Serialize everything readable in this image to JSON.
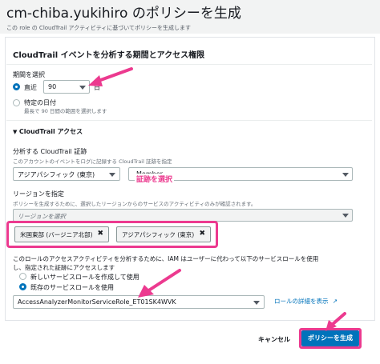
{
  "header": {
    "title": "cm-chiba.yukihiro のポリシーを生成",
    "description": "この role の CloudTrail アクティビティに基づいてポリシーを生成します"
  },
  "cloudtrail_section": {
    "title": "CloudTrail イベントを分析する期間とアクセス権限",
    "period_label": "期間を選択",
    "recent_label": "直近",
    "days_value": "90",
    "days_unit": "日",
    "specific_date_label": "特定の日付",
    "specific_date_hint": "最長で 90 日間の範囲を選択します"
  },
  "access_section": {
    "toggle_label": "CloudTrail アクセス",
    "trail_label": "分析する CloudTrail 証跡",
    "trail_hint": "このアカウントのイベントをログに記録する CloudTrail 証跡を指定",
    "trail_region_value": "アジアパシフィック (東京)",
    "trail_select_value": "Member",
    "annotation_trail": "証跡を選択",
    "region_label": "リージョンを指定",
    "region_hint": "ポリシーを生成するために、選択したリージョンからのサービスのアクティビティのみが確認されます。",
    "region_placeholder": "リージョンを選択",
    "region_tokens": [
      "米国東部 (バージニア北部)",
      "アジアパシフィック (東京)"
    ]
  },
  "service_role": {
    "description_line1": "このロールのアクセスアクティビティを分析するために、IAM はユーザーに代わって以下のサービスロールを使用",
    "description_line2": "し、指定された証跡にアクセスします",
    "option_new": "新しいサービスロールを作成して使用",
    "option_existing": "既存のサービスロールを使用",
    "role_value": "AccessAnalyzerMonitorServiceRole_ET01SK4WVK",
    "details_link": "ロールの詳細を表示"
  },
  "footer": {
    "cancel_label": "キャンセル",
    "generate_label": "ポリシーを生成"
  },
  "colors": {
    "primary": "#0073bb",
    "annotation": "#ec3a8f"
  }
}
